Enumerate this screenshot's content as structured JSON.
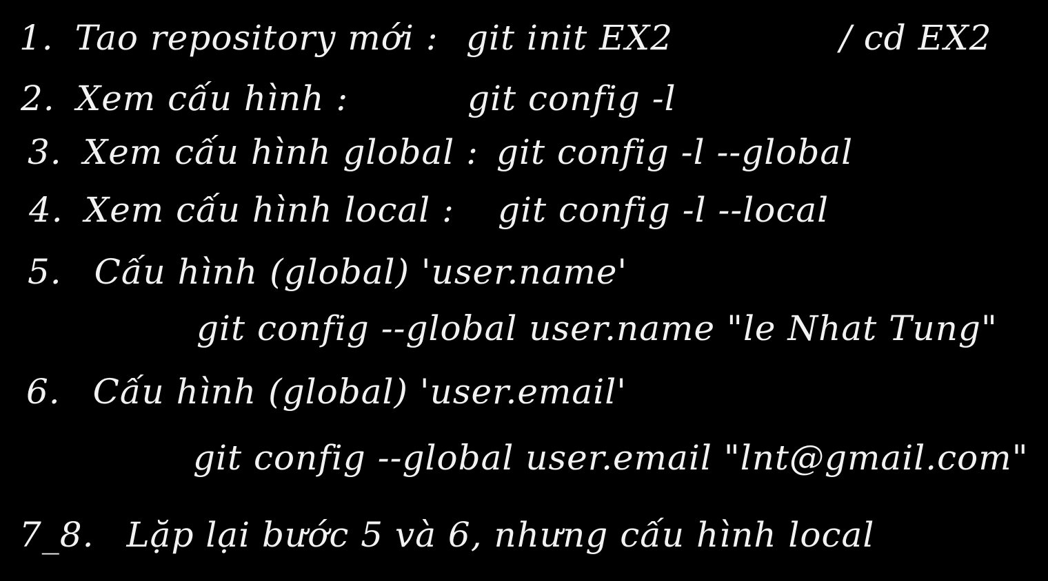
{
  "steps": [
    {
      "number": "1.",
      "label": "Tao repository mới :",
      "command": "git init EX2",
      "extra": "/ cd EX2"
    },
    {
      "number": "2.",
      "label": "Xem cấu hình :",
      "command": "git config -l"
    },
    {
      "number": "3.",
      "label": "Xem cấu hình global :",
      "command": "git config -l --global"
    },
    {
      "number": "4.",
      "label": "Xem cấu hình local :",
      "command": "git config -l --local"
    },
    {
      "number": "5.",
      "label": "Cấu hình (global) 'user.name'",
      "command": "git config --global user.name \"le Nhat Tung\""
    },
    {
      "number": "6.",
      "label": "Cấu hình (global) 'user.email'",
      "command": "git config --global user.email \"lnt@gmail.com\""
    },
    {
      "number": "7_8.",
      "label": "Lặp lại bước 5 và 6, nhưng cấu hình local"
    }
  ],
  "colors": {
    "background": "#000000",
    "ink": "#f2f2f2"
  }
}
